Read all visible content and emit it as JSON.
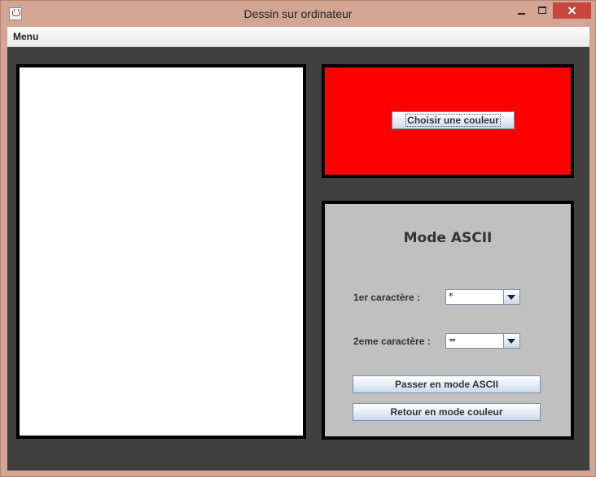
{
  "window": {
    "title": "Dessin sur ordinateur",
    "icon": "java-cup-icon",
    "controls": [
      "minimize",
      "maximize",
      "close"
    ]
  },
  "menubar": {
    "items": [
      {
        "label": "Menu"
      }
    ]
  },
  "color_panel": {
    "current_color": "#ff0000",
    "choose_button": "Choisir une couleur"
  },
  "ascii_panel": {
    "title": "Mode ASCII",
    "char1_label": "1er caractère :",
    "char1_value": "*",
    "char2_label": "2eme caractère :",
    "char2_value": "=",
    "ascii_button": "Passer en mode ASCII",
    "color_button": "Retour en mode couleur"
  },
  "colors": {
    "frame": "#d3a595",
    "background": "#404040",
    "canvas": "#ffffff",
    "ascii_panel": "#c0c0c0",
    "close_button": "#c8463c"
  }
}
